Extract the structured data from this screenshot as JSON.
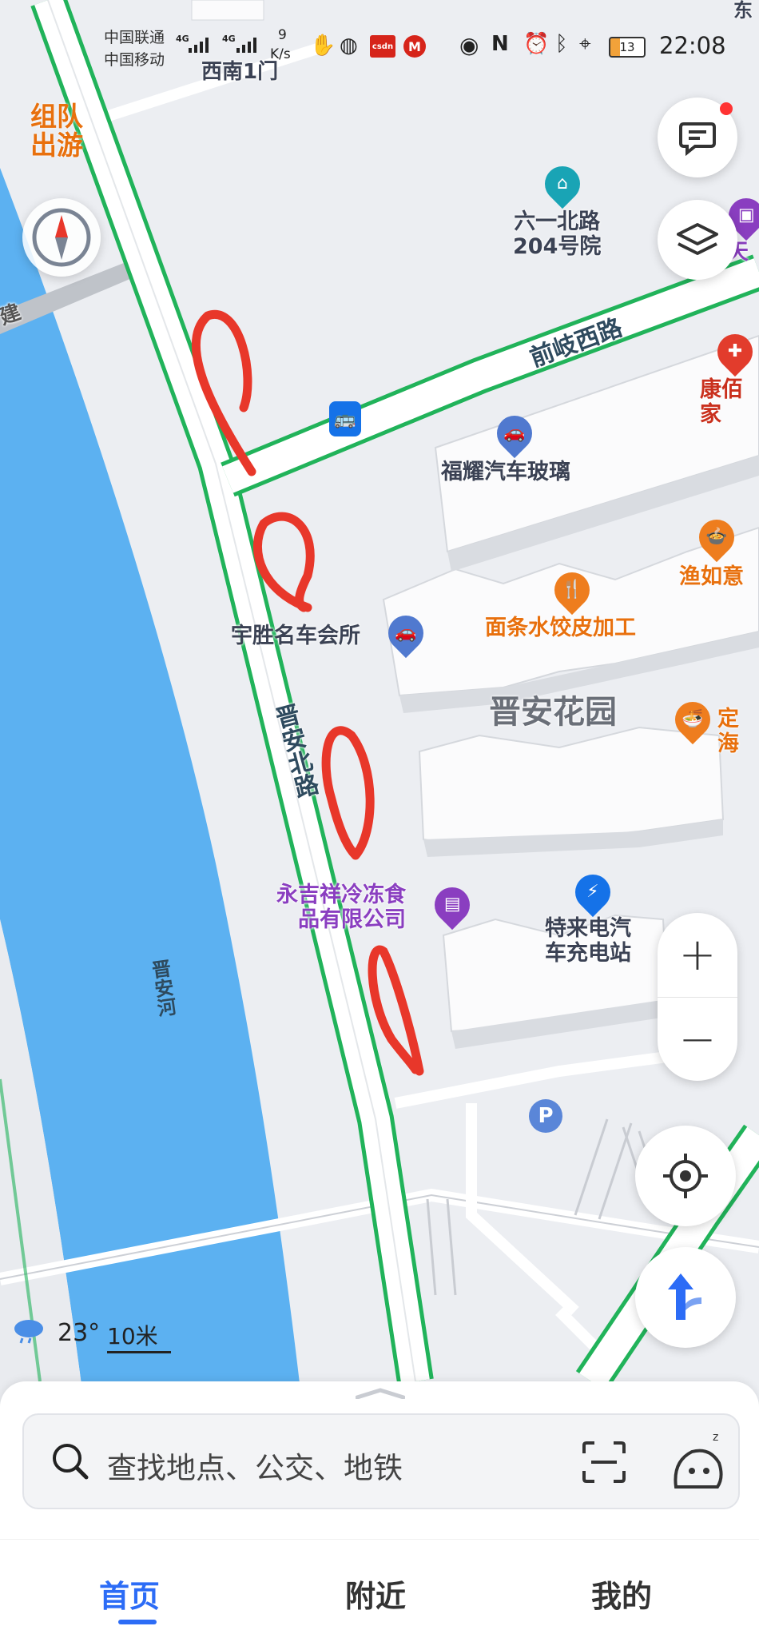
{
  "status_bar": {
    "carrier1": "中国联通",
    "carrier2": "中国移动",
    "net1": "4G",
    "net2": "4G",
    "speed": "9",
    "speed_unit": "K/s",
    "csdn": "csdn",
    "battery": "13",
    "time": "22:08"
  },
  "map": {
    "top_labels": [
      "西南1门",
      "东"
    ],
    "team_trip": "组队\n出游",
    "river_label": "晋安河",
    "left_edge_label": "建",
    "roads": {
      "qianqi": "前岐西路",
      "jinan_north": "晋安北路"
    },
    "pois": {
      "liuyi": "六一北路\n204号院",
      "kangbai": "康佰家",
      "fuyao": "福耀汽车玻璃",
      "yuru": "渔如意",
      "noodle": "面条水饺皮加工",
      "yusheng": "宇胜名车会所",
      "jinan_garden": "晋安花园",
      "dinghai": "定海",
      "yongjixiang": "永吉祥冷冻食\n品有限公司",
      "tesla": "特来电汽\n车充电站",
      "tian": "天"
    },
    "parking": "P"
  },
  "weather": {
    "temp": "23°",
    "scale": "10米"
  },
  "controls": {
    "zoom_in": "+",
    "zoom_out": "−"
  },
  "search": {
    "placeholder": "查找地点、公交、地铁"
  },
  "tabs": [
    {
      "label": "首页"
    },
    {
      "label": "附近"
    },
    {
      "label": "我的"
    }
  ],
  "colors": {
    "accent": "#2c6cf6",
    "river": "#5cb1f1",
    "route_green": "#21b35a",
    "annotation_red": "#e8372a",
    "map_bg": "#eceef2"
  }
}
